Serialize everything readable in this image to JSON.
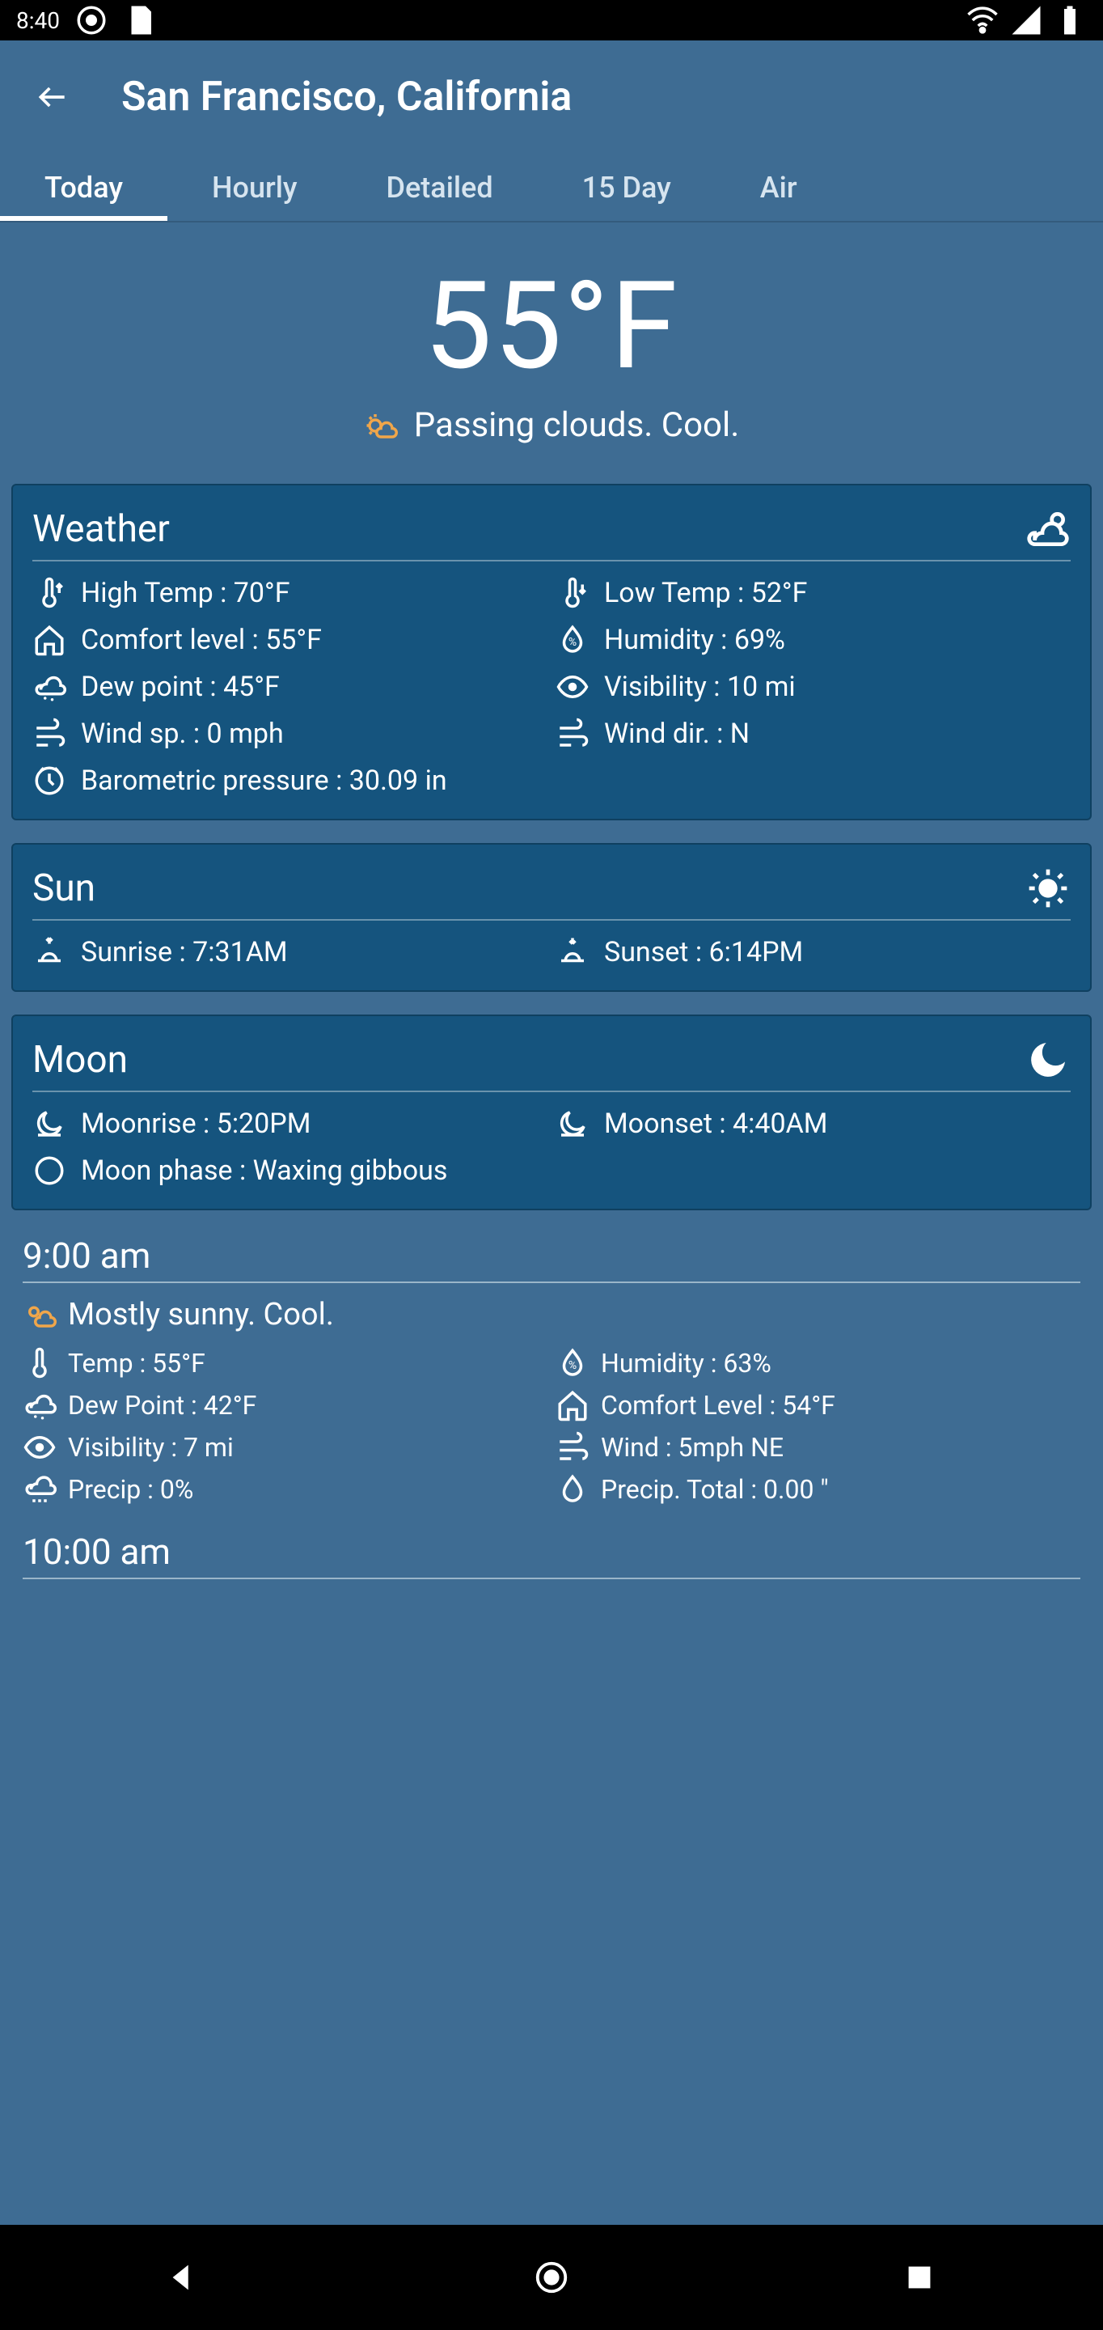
{
  "status": {
    "time": "8:40"
  },
  "header": {
    "title": "San Francisco, California"
  },
  "tabs": [
    "Today",
    "Hourly",
    "Detailed",
    "15 Day",
    "Air"
  ],
  "active_tab": 0,
  "hero": {
    "temp": "55°F",
    "desc": "Passing clouds. Cool."
  },
  "weather_card": {
    "title": "Weather",
    "items": [
      {
        "icon": "thermo-up-icon",
        "label": "High Temp : 70°F"
      },
      {
        "icon": "thermo-down-icon",
        "label": "Low Temp : 52°F"
      },
      {
        "icon": "home-icon",
        "label": "Comfort level : 55°F"
      },
      {
        "icon": "humidity-icon",
        "label": "Humidity : 69%"
      },
      {
        "icon": "cloud-dew-icon",
        "label": "Dew point : 45°F"
      },
      {
        "icon": "eye-icon",
        "label": "Visibility : 10 mi"
      },
      {
        "icon": "wind-icon",
        "label": "Wind sp. : 0 mph"
      },
      {
        "icon": "wind-icon",
        "label": "Wind dir. : N"
      },
      {
        "icon": "pressure-icon",
        "label": "Barometric pressure : 30.09 in",
        "full": true
      }
    ]
  },
  "sun_card": {
    "title": "Sun",
    "items": [
      {
        "icon": "sunrise-icon",
        "label": "Sunrise : 7:31AM"
      },
      {
        "icon": "sunset-icon",
        "label": "Sunset : 6:14PM"
      }
    ]
  },
  "moon_card": {
    "title": "Moon",
    "items": [
      {
        "icon": "moonrise-icon",
        "label": "Moonrise : 5:20PM"
      },
      {
        "icon": "moonset-icon",
        "label": "Moonset : 4:40AM"
      },
      {
        "icon": "moonphase-icon",
        "label": "Moon phase : Waxing gibbous",
        "full": true
      }
    ]
  },
  "hourly": [
    {
      "time": "9:00 am",
      "desc": "Mostly sunny. Cool.",
      "rows": [
        {
          "icon": "thermo-icon",
          "label": "Temp : 55°F"
        },
        {
          "icon": "humidity-icon",
          "label": "Humidity : 63%"
        },
        {
          "icon": "cloud-dew-icon",
          "label": "Dew Point : 42°F"
        },
        {
          "icon": "home-icon",
          "label": "Comfort Level : 54°F"
        },
        {
          "icon": "eye-icon",
          "label": "Visibility : 7 mi"
        },
        {
          "icon": "wind-icon",
          "label": "Wind : 5mph NE"
        },
        {
          "icon": "cloud-rain-icon",
          "label": "Precip : 0%"
        },
        {
          "icon": "drop-icon",
          "label": "Precip. Total : 0.00 \""
        }
      ]
    },
    {
      "time": "10:00 am",
      "desc": "",
      "rows": []
    }
  ]
}
